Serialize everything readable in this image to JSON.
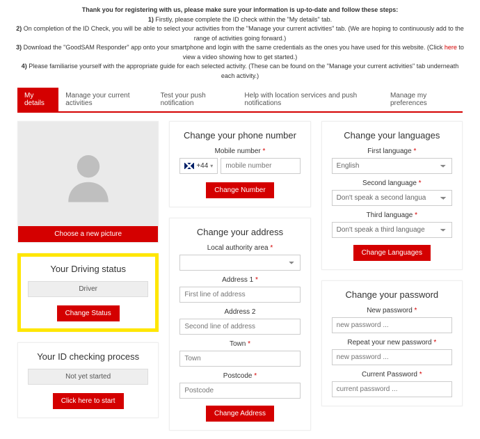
{
  "intro": {
    "heading": "Thank you for registering with us, please make sure your information is up-to-date and follow these steps:",
    "line1_prefix": "1)",
    "line1": " Firstly, please complete the ID check within the \"My details\" tab.",
    "line2_prefix": "2)",
    "line2": " On completion of the ID Check, you will be able to select your activities from the \"Manage your current activities\" tab. (We are hoping to continuously add to the range of activities going forward.)",
    "line3_prefix": "3)",
    "line3a": " Download the \"GoodSAM Responder\" app onto your smartphone and login with the same credentials as the ones you have used for this website. (Click ",
    "line3_link": "here",
    "line3b": " to view a video showing how to get started.)",
    "line4_prefix": "4)",
    "line4": " Please familiarise yourself with the appropriate guide for each selected activity. (These can be found on the \"Manage your current activities\" tab underneath each activity.)"
  },
  "tabs": [
    "My details",
    "Manage your current activities",
    "Test your push notification",
    "Help with location services and push notifications",
    "Manage my preferences"
  ],
  "picture": {
    "choose": "Choose a new picture"
  },
  "driving": {
    "title": "Your Driving status",
    "value": "Driver",
    "btn": "Change Status"
  },
  "idcheck": {
    "title": "Your ID checking process",
    "value": "Not yet started",
    "btn": "Click here to start"
  },
  "phone": {
    "title": "Change your phone number",
    "label": "Mobile number",
    "code": "+44",
    "placeholder": "mobile number",
    "btn": "Change Number"
  },
  "address": {
    "title": "Change your address",
    "area_label": "Local authority area",
    "addr1_label": "Address 1",
    "addr1_ph": "First line of address",
    "addr2_label": "Address 2",
    "addr2_ph": "Second line of address",
    "town_label": "Town",
    "town_ph": "Town",
    "postcode_label": "Postcode",
    "postcode_ph": "Postcode",
    "btn": "Change Address"
  },
  "lang": {
    "title": "Change your languages",
    "first_label": "First language",
    "first_val": "English",
    "second_label": "Second language",
    "second_val": "Don't speak a second langua",
    "third_label": "Third language",
    "third_val": "Don't speak a third language",
    "btn": "Change Languages"
  },
  "password": {
    "title": "Change your password",
    "new_label": "New password",
    "new_ph": "new password ...",
    "repeat_label": "Repeat your new password",
    "repeat_ph": "new password ...",
    "current_label": "Current Password",
    "current_ph": "current password ..."
  }
}
